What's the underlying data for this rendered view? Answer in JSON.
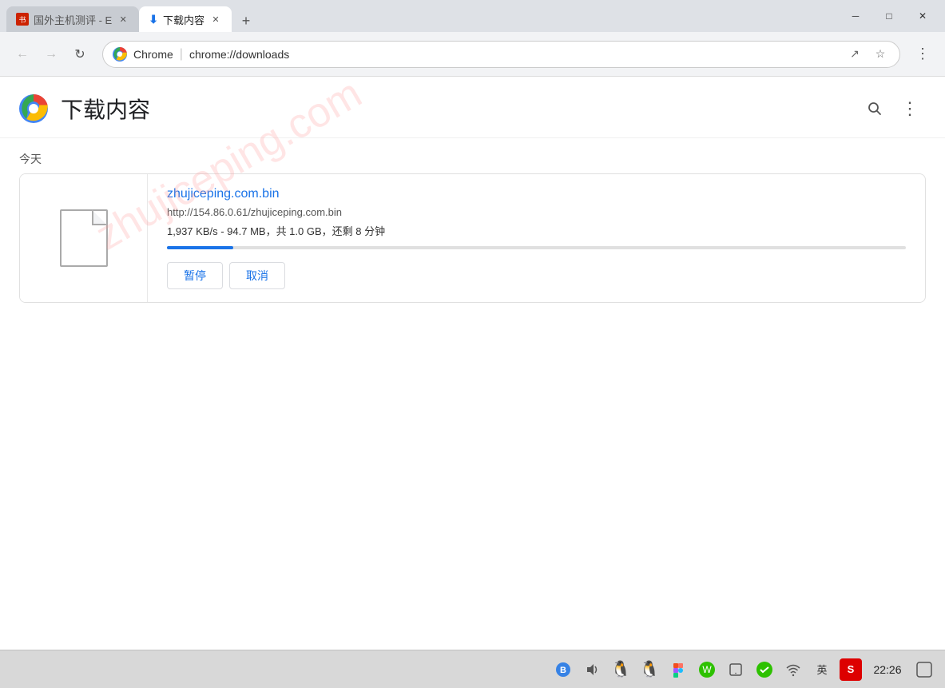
{
  "window": {
    "minimize_label": "─",
    "restore_label": "□",
    "close_label": "✕"
  },
  "tabs": {
    "inactive": {
      "favicon": "🔴",
      "title": "国外主机测评 - E",
      "close": "✕"
    },
    "active": {
      "download_icon": "⬇",
      "title": "下载内容",
      "close": "✕"
    },
    "new_tab": "+"
  },
  "nav": {
    "back": "←",
    "forward": "→",
    "reload": "↻",
    "brand": "Chrome",
    "separator": "|",
    "url": "chrome://downloads",
    "share_icon": "↗",
    "star_icon": "☆",
    "menu_icon": "⋮"
  },
  "page": {
    "title": "下载内容",
    "search_icon": "🔍",
    "menu_icon": "⋮",
    "watermark": "zhujiceping.com"
  },
  "downloads": {
    "section_today": "今天",
    "item": {
      "filename": "zhujiceping.com.bin",
      "url": "http://154.86.0.61/zhujiceping.com.bin",
      "speed_info": "1,937 KB/s - 94.7 MB，共 1.0 GB，还剩 8 分钟",
      "progress_percent": 9,
      "btn_pause": "暂停",
      "btn_cancel": "取消"
    }
  },
  "taskbar": {
    "bluetooth_icon": "🔵",
    "volume_icon": "🔊",
    "qq1_icon": "🐧",
    "qq2_icon": "🐧",
    "figma_icon": "✦",
    "wechat_icon": "💬",
    "tablet_icon": "📱",
    "check_icon": "✅",
    "wifi_icon": "📶",
    "lang_icon": "英",
    "sougou_icon": "S",
    "time": "22:26",
    "notification_icon": "🗨"
  }
}
